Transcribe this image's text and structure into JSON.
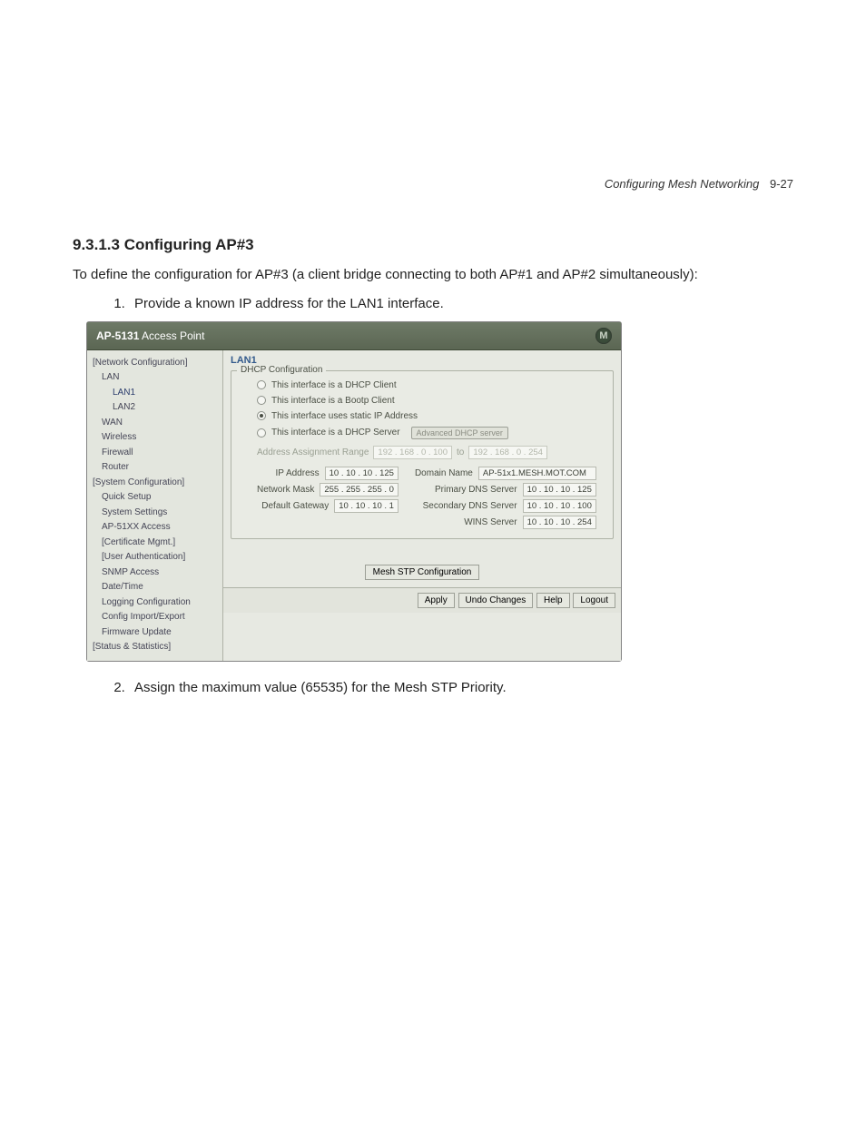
{
  "running_header": {
    "title": "Configuring Mesh Networking",
    "page": "9-27"
  },
  "heading": "9.3.1.3  Configuring AP#3",
  "intro": "To define the configuration for AP#3 (a client bridge connecting to both AP#1 and AP#2 simultaneously):",
  "steps": {
    "s1": "Provide a known IP address for the LAN1 interface.",
    "s2": "Assign the maximum value (65535) for the Mesh STP Priority."
  },
  "shot": {
    "brand_bold": "AP-5131",
    "brand_rest": " Access Point",
    "logo_letter": "M",
    "tree": [
      {
        "lbl": "[Network Configuration]",
        "lvl": 0
      },
      {
        "lbl": "LAN",
        "lvl": 1
      },
      {
        "lbl": "LAN1",
        "lvl": 2,
        "sel": true
      },
      {
        "lbl": "LAN2",
        "lvl": 2
      },
      {
        "lbl": "WAN",
        "lvl": 1
      },
      {
        "lbl": "Wireless",
        "lvl": 1
      },
      {
        "lbl": "Firewall",
        "lvl": 1
      },
      {
        "lbl": "Router",
        "lvl": 1
      },
      {
        "lbl": "[System Configuration]",
        "lvl": 0
      },
      {
        "lbl": "Quick Setup",
        "lvl": 1
      },
      {
        "lbl": "System Settings",
        "lvl": 1
      },
      {
        "lbl": "AP-51XX Access",
        "lvl": 1
      },
      {
        "lbl": "[Certificate Mgmt.]",
        "lvl": 1
      },
      {
        "lbl": "[User Authentication]",
        "lvl": 1
      },
      {
        "lbl": "SNMP Access",
        "lvl": 1
      },
      {
        "lbl": "Date/Time",
        "lvl": 1
      },
      {
        "lbl": "Logging Configuration",
        "lvl": 1
      },
      {
        "lbl": "Config Import/Export",
        "lvl": 1
      },
      {
        "lbl": "Firmware Update",
        "lvl": 1
      },
      {
        "lbl": "[Status & Statistics]",
        "lvl": 0
      }
    ],
    "content": {
      "title": "LAN1",
      "group_label": "DHCP Configuration",
      "radios": {
        "r1": "This interface is a DHCP Client",
        "r2": "This interface is a Bootp Client",
        "r3": "This interface uses static IP Address",
        "r4": "This interface is a DHCP Server"
      },
      "adv_btn": "Advanced DHCP server",
      "assign_label": "Address Assignment Range",
      "assign_from": "192 . 168 .  0  . 100",
      "assign_to_word": "to",
      "assign_to": "192 . 168 .  0  . 254",
      "left": {
        "ip_label": "IP Address",
        "ip_val": "10 .  10 .  10  . 125",
        "mask_label": "Network Mask",
        "mask_val": "255 . 255 . 255 .  0",
        "gw_label": "Default Gateway",
        "gw_val": "10 .  10 .  10  .  1"
      },
      "right": {
        "dn_label": "Domain Name",
        "dn_val": "AP-51x1.MESH.MOT.COM",
        "pdns_label": "Primary DNS Server",
        "pdns_val": "10 .  10 .  10  . 125",
        "sdns_label": "Secondary DNS Server",
        "sdns_val": "10 .  10 .  10  . 100",
        "wins_label": "WINS Server",
        "wins_val": "10 .  10 .  10  . 254"
      },
      "stp_btn": "Mesh STP Configuration"
    },
    "footer": {
      "apply": "Apply",
      "undo": "Undo Changes",
      "help": "Help",
      "logout": "Logout"
    }
  }
}
